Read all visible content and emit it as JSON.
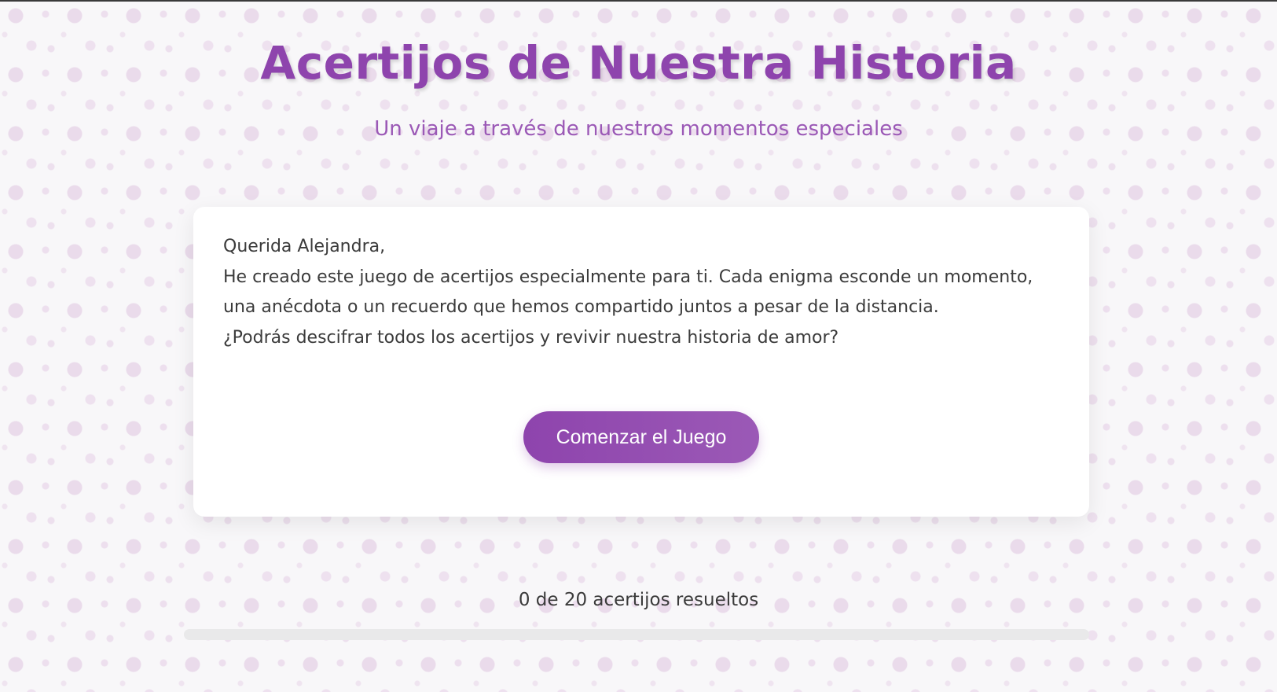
{
  "header": {
    "title": "Acertijos de Nuestra Historia",
    "subtitle": "Un viaje a través de nuestros momentos especiales"
  },
  "intro": {
    "greeting": "Querida Alejandra,",
    "paragraph": "He creado este juego de acertijos especialmente para ti. Cada enigma esconde un momento, una anécdota o un recuerdo que hemos compartido juntos a pesar de la distancia.",
    "question": "¿Podrás descifrar todos los acertijos y revivir nuestra historia de amor?",
    "start_label": "Comenzar el Juego"
  },
  "progress": {
    "label": "0 de 20 acertijos resueltos",
    "solved": 0,
    "total": 20
  },
  "colors": {
    "accent": "#8e44ad",
    "accent_light": "#9b59b6"
  }
}
